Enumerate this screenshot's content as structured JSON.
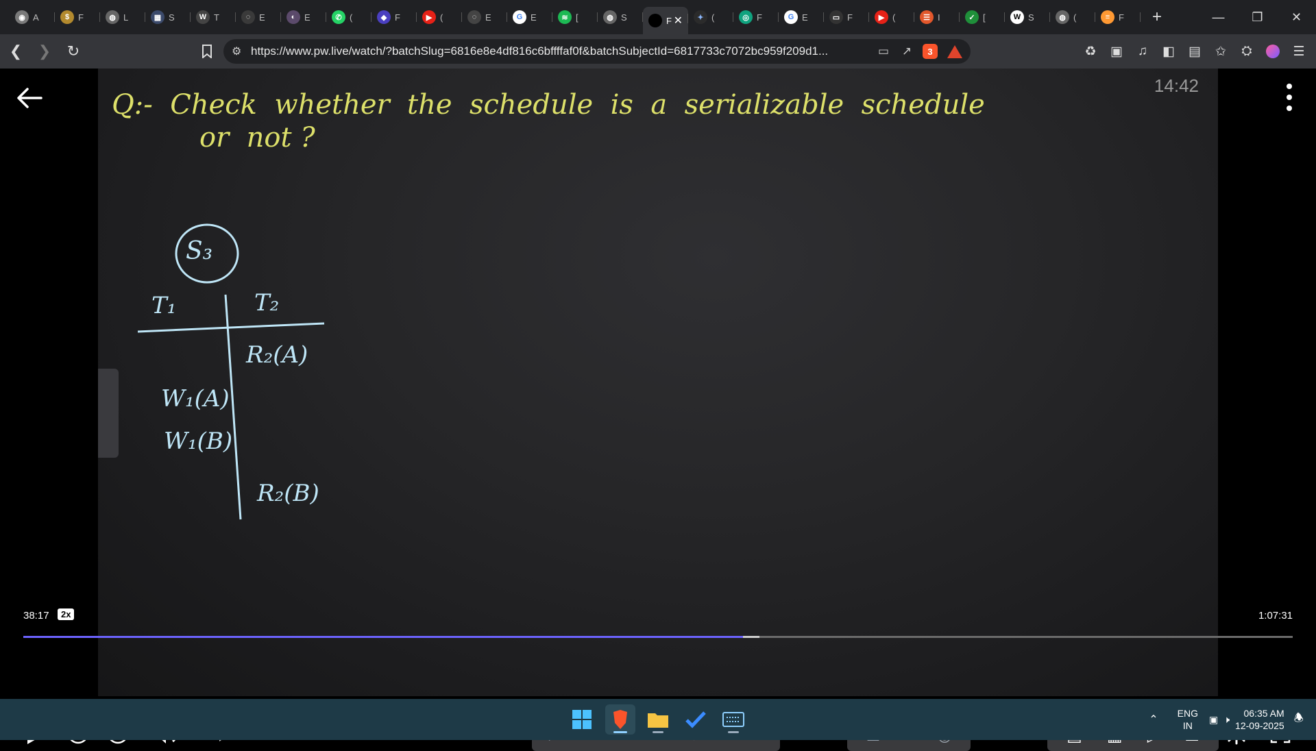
{
  "browser": {
    "tabs": [
      {
        "title": "A",
        "color": "#7a7a7a",
        "glyph": "◉"
      },
      {
        "title": "F",
        "color": "#b38a2e",
        "glyph": "$"
      },
      {
        "title": "L",
        "color": "#666",
        "glyph": "◍"
      },
      {
        "title": "S",
        "color": "#3b4a6b",
        "glyph": "▦"
      },
      {
        "title": "T",
        "color": "#444",
        "glyph": "W"
      },
      {
        "title": "E",
        "color": "#3a3a3a",
        "glyph": "◌"
      },
      {
        "title": "E",
        "color": "#5b4a6b",
        "glyph": "◐"
      },
      {
        "title": "(",
        "color": "#25d366",
        "glyph": "✆"
      },
      {
        "title": "F",
        "color": "#4a3fc0",
        "glyph": "◆"
      },
      {
        "title": "(",
        "color": "#e62117",
        "glyph": "▶"
      },
      {
        "title": "E",
        "color": "#444",
        "glyph": "◌"
      },
      {
        "title": "E",
        "color": "#fff",
        "glyph": "G",
        "glyph_color": "#4285f4"
      },
      {
        "title": "[",
        "color": "#1db954",
        "glyph": "≋"
      },
      {
        "title": "S",
        "color": "#666",
        "glyph": "◍"
      },
      {
        "title": "F",
        "color": "#000",
        "glyph": "",
        "active": true
      },
      {
        "title": "(",
        "color": "#2b2b2b",
        "glyph": "✦",
        "glyph_color": "#8ab4f8"
      },
      {
        "title": "F",
        "color": "#10a37f",
        "glyph": "◎"
      },
      {
        "title": "E",
        "color": "#fff",
        "glyph": "G",
        "glyph_color": "#4285f4"
      },
      {
        "title": "F",
        "color": "#333",
        "glyph": "▭"
      },
      {
        "title": "(",
        "color": "#e62117",
        "glyph": "▶"
      },
      {
        "title": "I",
        "color": "#e2572b",
        "glyph": "☰"
      },
      {
        "title": "[",
        "color": "#1f8f3a",
        "glyph": "✓"
      },
      {
        "title": "S",
        "color": "#fff",
        "glyph": "W",
        "glyph_color": "#000"
      },
      {
        "title": "(",
        "color": "#666",
        "glyph": "◍"
      },
      {
        "title": "F",
        "color": "#ff9933",
        "glyph": "≡"
      }
    ],
    "close_tab_glyph": "✕",
    "new_tab_glyph": "+",
    "url": "https://www.pw.live/watch/?batchSlug=6816e8e4df816c6bffffaf0f&batchSubjectId=6817733c7072bc959f209d1...",
    "shield_badge": "3"
  },
  "video": {
    "clock_time": "14:42",
    "question_line1": "Q:-  Check  whether  the  schedule  is  a  serializable  schedule",
    "question_line2": "or  not ?",
    "schedule_name": "S₃",
    "col_t1": "T₁",
    "col_t2": "T₂",
    "ops": [
      {
        "col": 2,
        "text": "R₂(A)"
      },
      {
        "col": 1,
        "text": "W₁(A)"
      },
      {
        "col": 1,
        "text": "W₁(B)"
      },
      {
        "col": 2,
        "text": "R₂(B)"
      }
    ],
    "current_time": "38:17",
    "speed": "2x",
    "total_time": "1:07:31",
    "progress_fraction": 0.567,
    "buffer_fraction": 0.58,
    "skip_seconds": "10"
  },
  "taskbar": {
    "lang_top": "ENG",
    "lang_bottom": "IN",
    "time": "06:35 AM",
    "date": "12-09-2025"
  }
}
